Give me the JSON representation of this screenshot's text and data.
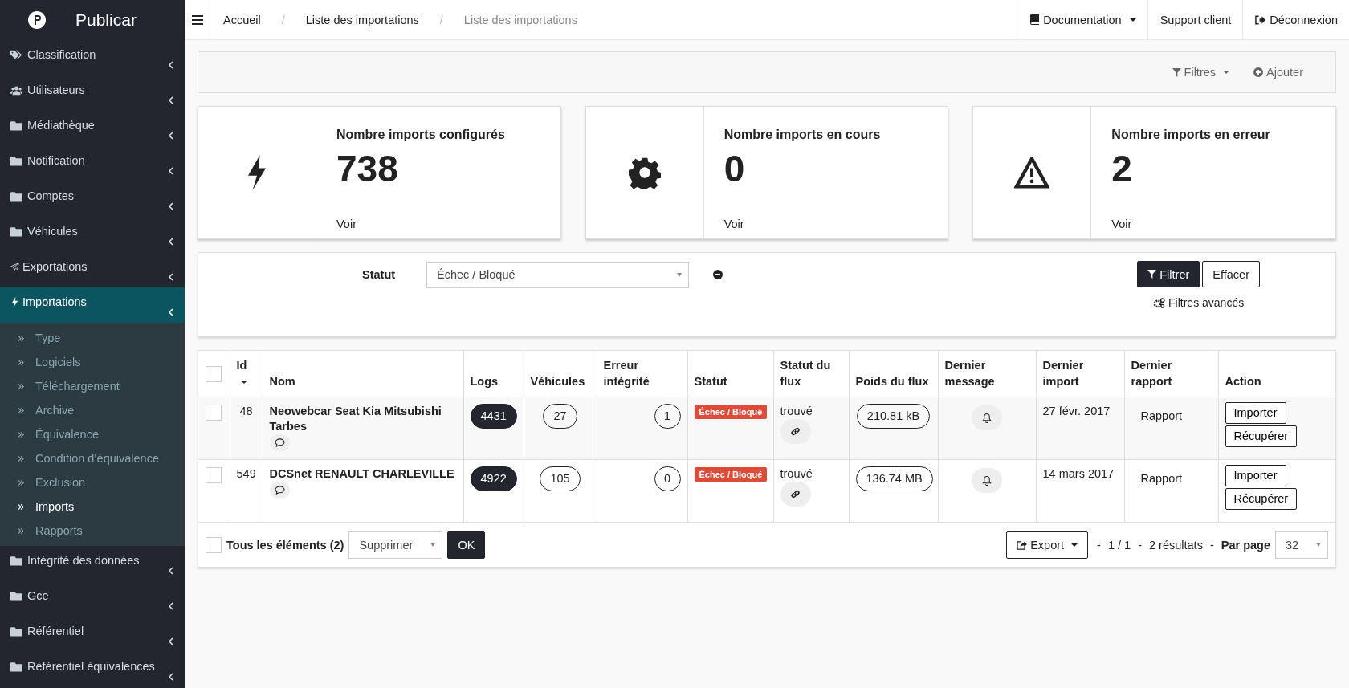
{
  "sidebar": {
    "brand": "Publicar",
    "items": [
      {
        "kind": "tags",
        "label": "Classification",
        "selected": false
      },
      {
        "kind": "users",
        "label": "Utilisateurs",
        "selected": false
      },
      {
        "kind": "folder",
        "label": "Médiathèque",
        "selected": false
      },
      {
        "kind": "folder",
        "label": "Notification",
        "selected": false
      },
      {
        "kind": "folder",
        "label": "Comptes",
        "selected": false
      },
      {
        "kind": "folder",
        "label": "Véhicules",
        "selected": false
      },
      {
        "kind": "send",
        "label": "Exportations",
        "selected": false
      },
      {
        "kind": "bolt",
        "label": "Importations",
        "selected": true,
        "children": [
          {
            "label": "Type",
            "selected": false
          },
          {
            "label": "Logiciels",
            "selected": false
          },
          {
            "label": "Téléchargement",
            "selected": false
          },
          {
            "label": "Archive",
            "selected": false
          },
          {
            "label": "Équivalence",
            "selected": false
          },
          {
            "label": "Condition d’équivalence",
            "selected": false
          },
          {
            "label": "Exclusion",
            "selected": false
          },
          {
            "label": "Imports",
            "selected": true
          },
          {
            "label": "Rapports",
            "selected": false
          }
        ]
      },
      {
        "kind": "folder",
        "label": "Intégrité des données",
        "selected": false
      },
      {
        "kind": "folder",
        "label": "Gce",
        "selected": false
      },
      {
        "kind": "folder",
        "label": "Référentiel",
        "selected": false
      },
      {
        "kind": "folder",
        "label": "Référentiel équivalences",
        "selected": false
      }
    ]
  },
  "breadcrumb": [
    {
      "label": "Accueil",
      "current": false
    },
    {
      "separator": "/",
      "label": "Liste des importations",
      "current": false
    },
    {
      "separator": "/",
      "label": "Liste des importations",
      "current": true
    }
  ],
  "top_nav": [
    {
      "kind": "book",
      "label": "Documentation",
      "dropdown": true
    },
    {
      "kind": "none",
      "label": "Support client",
      "dropdown": false
    },
    {
      "kind": "logout",
      "label": "Déconnexion",
      "dropdown": false
    }
  ],
  "toolbar": {
    "filters": "Filtres",
    "add": "Ajouter"
  },
  "stats": [
    {
      "kind": "bolt",
      "title": "Nombre imports configurés",
      "value": "738",
      "link": "Voir"
    },
    {
      "kind": "gear",
      "title": "Nombre imports en cours",
      "value": "0",
      "link": "Voir"
    },
    {
      "kind": "warning",
      "title": "Nombre imports en erreur",
      "value": "2",
      "link": "Voir"
    }
  ],
  "filter": {
    "label": "Statut",
    "value": "Échec / Bloqué",
    "apply": "Filtrer",
    "clear": "Effacer",
    "advanced": "Filtres avancés"
  },
  "table": {
    "all_checked": false,
    "columns": [
      {
        "label": "Id",
        "sorted": true
      },
      {
        "label": "Nom",
        "sorted": false
      },
      {
        "label": "Logs",
        "sorted": false
      },
      {
        "label": "Véhicules",
        "sorted": false
      },
      {
        "label": "Erreur intégrité",
        "sorted": false
      },
      {
        "label": "Statut",
        "sorted": false
      },
      {
        "label": "Statut du flux",
        "sorted": false
      },
      {
        "label": "Poids du flux",
        "sorted": false
      },
      {
        "label": "Dernier message",
        "sorted": false
      },
      {
        "label": "Dernier import",
        "sorted": false
      },
      {
        "label": "Dernier rapport",
        "sorted": false
      },
      {
        "label": "Action",
        "sorted": false
      }
    ],
    "rows": [
      {
        "checked": false,
        "id": "48",
        "name": "Neowebcar Seat Kia Mitsubishi Tarbes",
        "logs": "4431",
        "vehicles": "27",
        "integrity": "1",
        "status": "Échec / Bloqué",
        "flux_status": "trouvé",
        "weight": "210.81 kB",
        "last_import": "27 févr. 2017",
        "report": "Rapport",
        "actions": [
          "Importer",
          "Récupérer"
        ]
      },
      {
        "checked": false,
        "id": "549",
        "name": "DCSnet RENAULT CHARLEVILLE",
        "logs": "4922",
        "vehicles": "105",
        "integrity": "0",
        "status": "Échec / Bloqué",
        "flux_status": "trouvé",
        "weight": "136.74 MB",
        "last_import": "14 mars 2017",
        "report": "Rapport",
        "actions": [
          "Importer",
          "Récupérer"
        ]
      }
    ]
  },
  "footer": {
    "select_all_checked": false,
    "select_all": "Tous les éléments (2)",
    "bulk_action": "Supprimer",
    "ok": "OK",
    "export": "Export",
    "separators": [
      "-",
      "-",
      "-"
    ],
    "pages": "1 / 1",
    "results": "2 résultats",
    "per_page_label": "Par page",
    "per_page": "32"
  }
}
